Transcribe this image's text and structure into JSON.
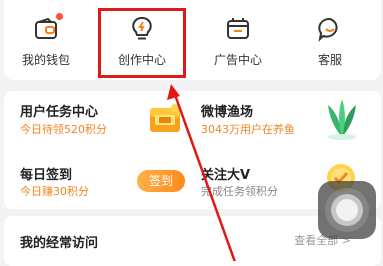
{
  "top_nav": {
    "items": [
      {
        "label": "我的钱包",
        "icon": "wallet-icon"
      },
      {
        "label": "创作中心",
        "icon": "lightbulb-icon"
      },
      {
        "label": "广告中心",
        "icon": "calendar-icon"
      },
      {
        "label": "客服",
        "icon": "chat-smile-icon"
      }
    ],
    "badge_color": "#ff4d3a"
  },
  "tasks": {
    "user_tasks": {
      "title": "用户任务中心",
      "subtitle": "今日待领520积分"
    },
    "weibo_fishing": {
      "title": "微博渔场",
      "subtitle": "3043万用户在养鱼"
    },
    "daily_signin": {
      "title": "每日签到",
      "subtitle": "今日赚30积分",
      "button": "签到"
    },
    "follow_v": {
      "title": "关注大V",
      "subtitle": "完成任务领积分"
    }
  },
  "frequent": {
    "title": "我的经常访问",
    "view_all": "查看全部 >"
  },
  "colors": {
    "accent": "#f5841f",
    "highlight": "#e11818",
    "arrow": "#e11818"
  }
}
